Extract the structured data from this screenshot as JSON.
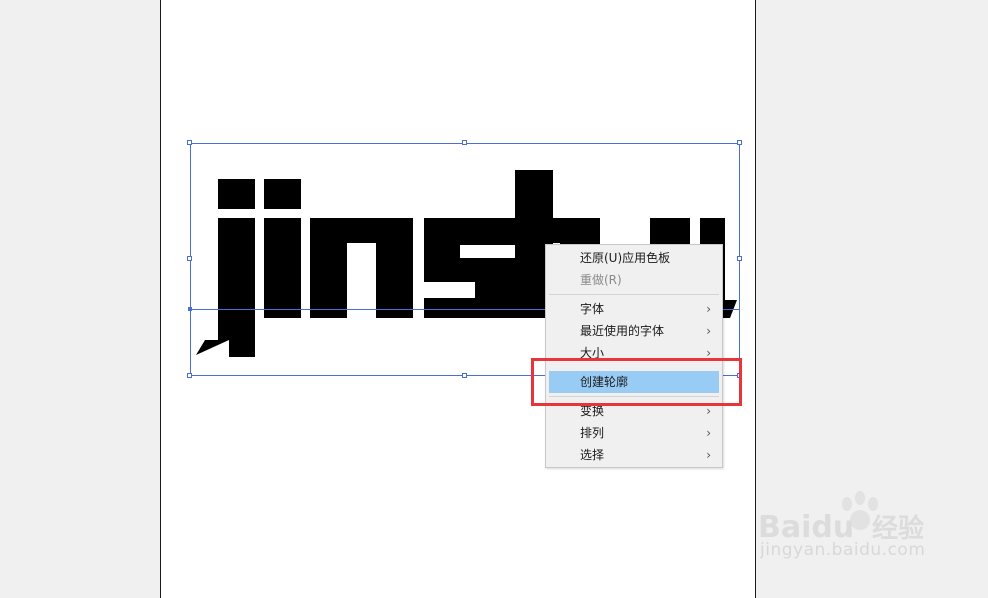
{
  "artwork": {
    "text": "jinshu",
    "fill": "#000000"
  },
  "selection": {
    "color": "#4a6ed6"
  },
  "context_menu": {
    "items": [
      {
        "label": "还原(U)应用色板",
        "disabled": false,
        "submenu": false
      },
      {
        "label": "重做(R)",
        "disabled": true,
        "submenu": false
      },
      {
        "label": "字体",
        "disabled": false,
        "submenu": true
      },
      {
        "label": "最近使用的字体",
        "disabled": false,
        "submenu": true
      },
      {
        "label": "大小",
        "disabled": false,
        "submenu": true
      },
      {
        "label": "创建轮廓",
        "disabled": false,
        "submenu": false,
        "highlighted": true
      },
      {
        "label": "变换",
        "disabled": false,
        "submenu": true
      },
      {
        "label": "排列",
        "disabled": false,
        "submenu": true
      },
      {
        "label": "选择",
        "disabled": false,
        "submenu": true
      }
    ],
    "submenu_glyph": "›",
    "highlight_color": "#99ccf5"
  },
  "annotation": {
    "color": "#e8353b"
  },
  "watermark": {
    "brand": "Baidu",
    "brand_cn": "经验",
    "url": "jingyan.baidu.com"
  }
}
